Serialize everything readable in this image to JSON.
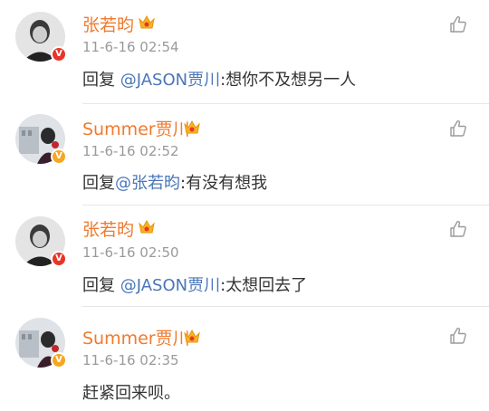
{
  "comments": [
    {
      "name": "张若昀",
      "time": "11-6-16 02:54",
      "reply_prefix": "回复 ",
      "mention": "@JASON贾川",
      "separator": ":",
      "text": "想你不及想另一人",
      "badge": "V",
      "badge_color": "#e8352a"
    },
    {
      "name": "Summer贾川",
      "time": "11-6-16 02:52",
      "reply_prefix": "回复",
      "mention": "@张若昀",
      "separator": ":",
      "text": "有没有想我",
      "badge": "V",
      "badge_color": "#f5a623"
    },
    {
      "name": "张若昀",
      "time": "11-6-16 02:50",
      "reply_prefix": "回复 ",
      "mention": "@JASON贾川",
      "separator": ":",
      "text": "太想回去了",
      "badge": "V",
      "badge_color": "#e8352a"
    },
    {
      "name": "Summer贾川",
      "time": "11-6-16 02:35",
      "reply_prefix": "",
      "mention": "",
      "separator": "",
      "text": "赶紧回来呗。",
      "badge": "V",
      "badge_color": "#f5a623"
    }
  ],
  "colors": {
    "name": "#f07a2d",
    "mention": "#4a76b8",
    "time": "#9a9a9a",
    "text": "#333333"
  },
  "icons": {
    "like": "thumbs-up-icon",
    "crown": "vip-crown-icon"
  }
}
